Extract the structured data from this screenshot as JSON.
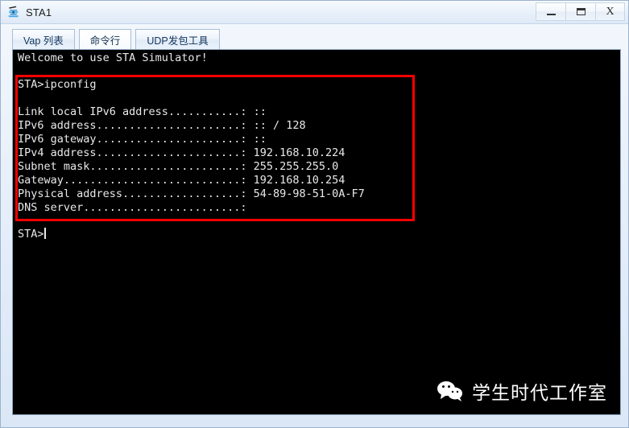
{
  "window": {
    "title": "STA1",
    "icon": "sta-device-icon",
    "controls": [
      {
        "name": "minimize-button",
        "glyph": "–",
        "label": "Minimize"
      },
      {
        "name": "maximize-button",
        "glyph": "□",
        "label": "Maximize"
      },
      {
        "name": "close-button",
        "glyph": "X",
        "label": "Close"
      }
    ]
  },
  "tabs": [
    {
      "label": "Vap 列表",
      "active": false
    },
    {
      "label": "命令行",
      "active": true
    },
    {
      "label": "UDP发包工具",
      "active": false
    }
  ],
  "terminal": {
    "welcome": "Welcome to use STA Simulator!",
    "command_line": "STA>ipconfig",
    "blank_line": "",
    "output": [
      "Link local IPv6 address...........: ::",
      "IPv6 address......................: :: / 128",
      "IPv6 gateway......................: ::",
      "IPv4 address......................: 192.168.10.224",
      "Subnet mask.......................: 255.255.255.0",
      "Gateway...........................: 192.168.10.254",
      "Physical address..................: 54-89-98-51-0A-F7",
      "DNS server........................:"
    ],
    "fields": [
      {
        "label": "Link local IPv6 address",
        "value": "::"
      },
      {
        "label": "IPv6 address",
        "value": ":: / 128"
      },
      {
        "label": "IPv6 gateway",
        "value": "::"
      },
      {
        "label": "IPv4 address",
        "value": "192.168.10.224"
      },
      {
        "label": "Subnet mask",
        "value": "255.255.255.0"
      },
      {
        "label": "Gateway",
        "value": "192.168.10.254"
      },
      {
        "label": "Physical address",
        "value": "54-89-98-51-0A-F7"
      },
      {
        "label": "DNS server",
        "value": ""
      }
    ],
    "prompt": "STA>",
    "highlight_color": "#ff0000",
    "background_color": "#000000",
    "text_color": "#e9e9e9"
  },
  "watermark": {
    "icon": "wechat-icon",
    "text": "学生时代工作室"
  }
}
